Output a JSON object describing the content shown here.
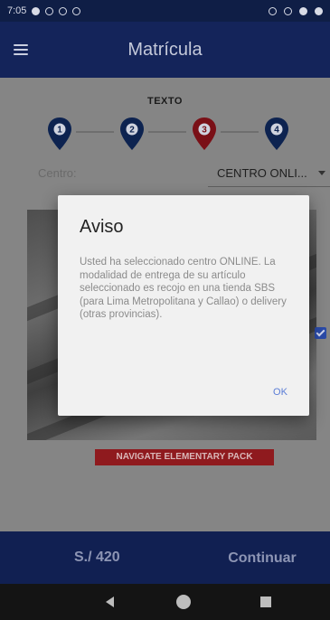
{
  "status_bar": {
    "time": "7:05"
  },
  "app_bar": {
    "title": "Matrícula",
    "menu_icon": "hamburger-menu-icon"
  },
  "steps": {
    "title": "TEXTO",
    "items": [
      {
        "number": "1",
        "state": "done"
      },
      {
        "number": "2",
        "state": "done"
      },
      {
        "number": "3",
        "state": "current"
      },
      {
        "number": "4",
        "state": "pending"
      }
    ],
    "colors": {
      "done": "#0d2350",
      "current": "#7a1017",
      "pending": "#0d2350"
    }
  },
  "center": {
    "label": "Centro:",
    "value": "CENTRO ONLI..."
  },
  "product": {
    "pack_label": "NAVIGATE ELEMENTARY PACK",
    "selected": true
  },
  "footer": {
    "price": "S./ 420",
    "continue_label": "Continuar"
  },
  "dialog": {
    "title": "Aviso",
    "message": "Usted ha seleccionado centro ONLINE. La modalidad de entrega de su artículo seleccionado es recojo en una tienda SBS (para Lima Metropolitana y Callao) o delivery (otras provincias).",
    "ok_label": "OK"
  },
  "colors": {
    "primary": "#14245a",
    "accent_red": "#8f1a1e",
    "link_blue": "#5b7dd6"
  }
}
